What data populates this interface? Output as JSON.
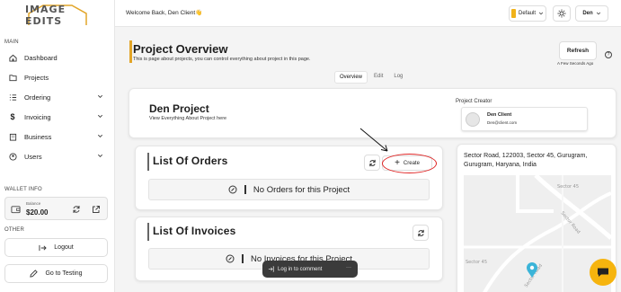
{
  "brand": {
    "logo_text": "IMAGE EDITS"
  },
  "sidebar": {
    "main_label": "MAIN",
    "items": [
      {
        "label": "Dashboard",
        "icon": "home-icon"
      },
      {
        "label": "Projects",
        "icon": "folder-icon"
      },
      {
        "label": "Ordering",
        "icon": "list-icon",
        "expandable": true
      },
      {
        "label": "Invoicing",
        "icon": "dollar-icon",
        "expandable": true
      },
      {
        "label": "Business",
        "icon": "building-icon",
        "expandable": true
      },
      {
        "label": "Users",
        "icon": "users-icon",
        "expandable": true
      }
    ],
    "wallet_label": "WALLET INFO",
    "wallet": {
      "balance_label": "Balance",
      "balance_value": "$20.00"
    },
    "other_label": "OTHER",
    "logout_label": "Logout",
    "testing_label": "Go to Testing"
  },
  "topbar": {
    "welcome": "Welcome Back, Den Client👋",
    "theme_label": "Default",
    "user_label": "Den",
    "accent": "#e2a528"
  },
  "page": {
    "title": "Project Overview",
    "subtitle": "This is page about projects, you can control everything about project in this page.",
    "refresh_label": "Refresh",
    "refresh_time": "A Few Seconds Ago",
    "help": "?",
    "tabs": [
      "Overview",
      "Edit",
      "Log"
    ],
    "active_tab": "Overview"
  },
  "project": {
    "name": "Den Project",
    "subtitle": "View Everything About Project here",
    "creator_label": "Project Creator",
    "creator_name": "Den Client",
    "creator_email": "Den@client.com"
  },
  "orders": {
    "title": "List Of Orders",
    "create_label": "Create",
    "empty_text": "No Orders for this Project"
  },
  "invoices": {
    "title": "List Of Invoices",
    "empty_text": "No Invoices for this Project"
  },
  "location": {
    "address": "Sector Road, 122003, Sector 45, Gurugram, Gurugram, Haryana, India",
    "map_labels": [
      "Sector Road",
      "Sector 45",
      "Sector 45",
      "Sector Road"
    ]
  },
  "toast": {
    "text": "Log in to comment",
    "more": "···"
  }
}
